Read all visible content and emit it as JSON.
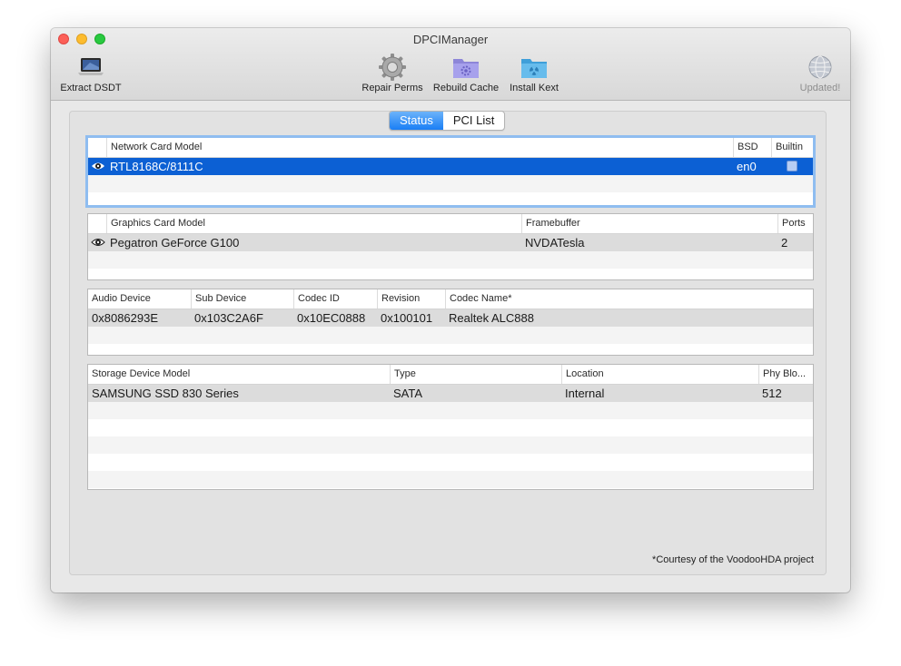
{
  "window": {
    "title": "DPCIManager"
  },
  "toolbar": {
    "extract_dsdt": {
      "label": "Extract DSDT",
      "icon": "laptop-icon"
    },
    "repair_perms": {
      "label": "Repair Perms",
      "icon": "gear-icon"
    },
    "rebuild_cache": {
      "label": "Rebuild Cache",
      "icon": "folder-gear-icon"
    },
    "install_kext": {
      "label": "Install Kext",
      "icon": "folder-radioactive-icon"
    },
    "updated": {
      "label": "Updated!",
      "icon": "globe-icon",
      "enabled": false
    }
  },
  "tabs": {
    "status": "Status",
    "pci_list": "PCI List",
    "selected": "Status"
  },
  "network": {
    "headers": {
      "model": "Network Card Model",
      "bsd": "BSD",
      "builtin": "Builtin"
    },
    "rows": [
      {
        "model": "RTL8168C/8111C",
        "bsd": "en0",
        "builtin": true,
        "selected": true
      }
    ]
  },
  "graphics": {
    "headers": {
      "model": "Graphics Card Model",
      "framebuffer": "Framebuffer",
      "ports": "Ports"
    },
    "rows": [
      {
        "model": "Pegatron GeForce G100",
        "framebuffer": "NVDATesla",
        "ports": "2"
      }
    ]
  },
  "audio": {
    "headers": {
      "device": "Audio Device",
      "sub_device": "Sub Device",
      "codec_id": "Codec ID",
      "revision": "Revision",
      "codec_name": "Codec Name*"
    },
    "rows": [
      {
        "device": "0x8086293E",
        "sub_device": "0x103C2A6F",
        "codec_id": "0x10EC0888",
        "revision": "0x100101",
        "codec_name": "Realtek ALC888"
      }
    ]
  },
  "storage": {
    "headers": {
      "model": "Storage Device Model",
      "type": "Type",
      "location": "Location",
      "block": "Phy Blo..."
    },
    "rows": [
      {
        "model": "SAMSUNG SSD 830 Series",
        "type": "SATA",
        "location": "Internal",
        "block": "512"
      }
    ]
  },
  "footnote": "*Courtesy of the VoodooHDA project",
  "colors": {
    "selection": "#0c60d4",
    "accent": "#1a7ef5",
    "focus_ring": "#8fbdf0"
  }
}
